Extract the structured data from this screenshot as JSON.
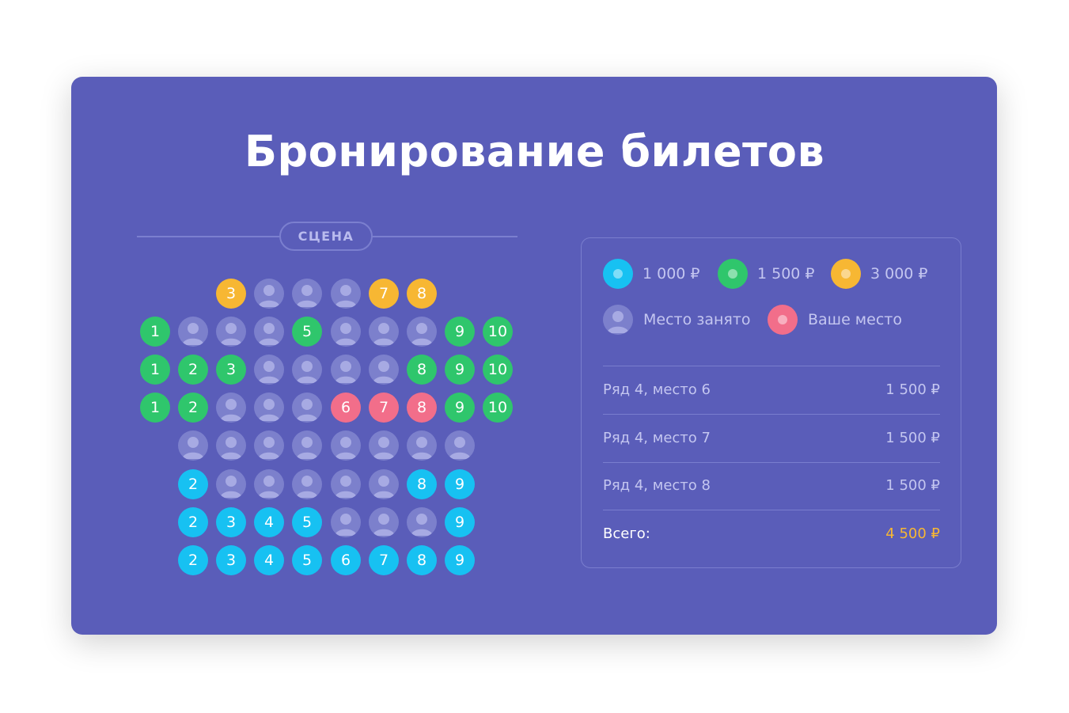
{
  "title": "Бронирование билетов",
  "stage_label": "СЦЕНА",
  "colors": {
    "blue": "#17c1f2",
    "green": "#2fc66c",
    "yellow": "#f7b733",
    "pink": "#f26e8a",
    "taken": "#7c80cc",
    "background": "#5a5db9"
  },
  "legend": {
    "price_1": "1 000 ₽",
    "price_2": "1 500 ₽",
    "price_3": "3 000 ₽",
    "taken": "Место занято",
    "yours": "Ваше место"
  },
  "rows": [
    {
      "offset": 2,
      "seats": [
        {
          "num": "3",
          "state": "yellow"
        },
        {
          "state": "taken"
        },
        {
          "state": "taken"
        },
        {
          "state": "taken"
        },
        {
          "num": "7",
          "state": "yellow"
        },
        {
          "num": "8",
          "state": "yellow"
        }
      ]
    },
    {
      "offset": 0,
      "seats": [
        {
          "num": "1",
          "state": "green"
        },
        {
          "state": "taken"
        },
        {
          "state": "taken"
        },
        {
          "state": "taken"
        },
        {
          "num": "5",
          "state": "green"
        },
        {
          "state": "taken"
        },
        {
          "state": "taken"
        },
        {
          "state": "taken"
        },
        {
          "num": "9",
          "state": "green"
        },
        {
          "num": "10",
          "state": "green"
        }
      ]
    },
    {
      "offset": 0,
      "seats": [
        {
          "num": "1",
          "state": "green"
        },
        {
          "num": "2",
          "state": "green"
        },
        {
          "num": "3",
          "state": "green"
        },
        {
          "state": "taken"
        },
        {
          "state": "taken"
        },
        {
          "state": "taken"
        },
        {
          "state": "taken"
        },
        {
          "num": "8",
          "state": "green"
        },
        {
          "num": "9",
          "state": "green"
        },
        {
          "num": "10",
          "state": "green"
        }
      ]
    },
    {
      "offset": 0,
      "seats": [
        {
          "num": "1",
          "state": "green"
        },
        {
          "num": "2",
          "state": "green"
        },
        {
          "state": "taken"
        },
        {
          "state": "taken"
        },
        {
          "state": "taken"
        },
        {
          "num": "6",
          "state": "pink"
        },
        {
          "num": "7",
          "state": "pink"
        },
        {
          "num": "8",
          "state": "pink"
        },
        {
          "num": "9",
          "state": "green"
        },
        {
          "num": "10",
          "state": "green"
        }
      ]
    },
    {
      "offset": 1,
      "seats": [
        {
          "state": "taken"
        },
        {
          "state": "taken"
        },
        {
          "state": "taken"
        },
        {
          "state": "taken"
        },
        {
          "state": "taken"
        },
        {
          "state": "taken"
        },
        {
          "state": "taken"
        },
        {
          "state": "taken"
        }
      ]
    },
    {
      "offset": 1,
      "seats": [
        {
          "num": "2",
          "state": "blue"
        },
        {
          "state": "taken"
        },
        {
          "state": "taken"
        },
        {
          "state": "taken"
        },
        {
          "state": "taken"
        },
        {
          "state": "taken"
        },
        {
          "num": "8",
          "state": "blue"
        },
        {
          "num": "9",
          "state": "blue"
        }
      ]
    },
    {
      "offset": 1,
      "seats": [
        {
          "num": "2",
          "state": "blue"
        },
        {
          "num": "3",
          "state": "blue"
        },
        {
          "num": "4",
          "state": "blue"
        },
        {
          "num": "5",
          "state": "blue"
        },
        {
          "state": "taken"
        },
        {
          "state": "taken"
        },
        {
          "state": "taken"
        },
        {
          "num": "9",
          "state": "blue"
        }
      ]
    },
    {
      "offset": 1,
      "seats": [
        {
          "num": "2",
          "state": "blue"
        },
        {
          "num": "3",
          "state": "blue"
        },
        {
          "num": "4",
          "state": "blue"
        },
        {
          "num": "5",
          "state": "blue"
        },
        {
          "num": "6",
          "state": "blue"
        },
        {
          "num": "7",
          "state": "blue"
        },
        {
          "num": "8",
          "state": "blue"
        },
        {
          "num": "9",
          "state": "blue"
        }
      ]
    }
  ],
  "selected": [
    {
      "label": "Ряд 4, место 6",
      "price": "1 500 ₽"
    },
    {
      "label": "Ряд 4, место 7",
      "price": "1 500 ₽"
    },
    {
      "label": "Ряд 4, место 8",
      "price": "1 500 ₽"
    }
  ],
  "total_label": "Всего:",
  "total_value": "4 500 ₽"
}
